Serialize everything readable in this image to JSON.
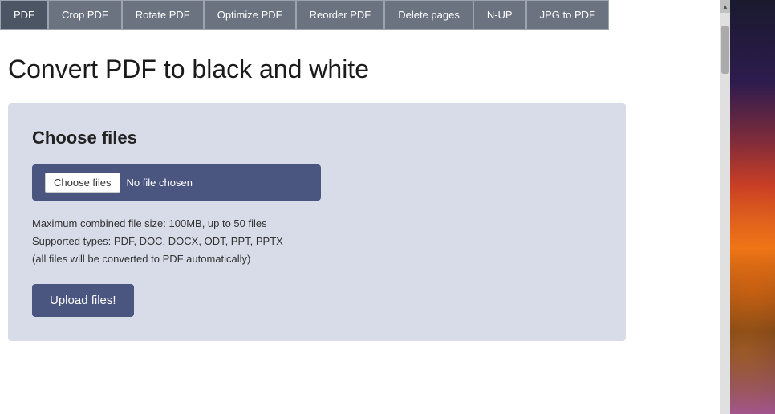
{
  "toolbar": {
    "buttons": [
      {
        "label": "PDF",
        "id": "pdf"
      },
      {
        "label": "Crop PDF",
        "id": "crop-pdf"
      },
      {
        "label": "Rotate PDF",
        "id": "rotate-pdf"
      },
      {
        "label": "Optimize PDF",
        "id": "optimize-pdf"
      },
      {
        "label": "Reorder PDF",
        "id": "reorder-pdf"
      },
      {
        "label": "Delete pages",
        "id": "delete-pages"
      },
      {
        "label": "N-UP",
        "id": "n-up"
      },
      {
        "label": "JPG to PDF",
        "id": "jpg-to-pdf"
      }
    ]
  },
  "page": {
    "title": "Convert PDF to black and white",
    "upload_section": {
      "heading": "Choose files",
      "file_button_label": "Choose files",
      "no_file_text": "No file chosen",
      "info_line1": "Maximum combined file size: 100MB, up to 50 files",
      "info_line2": "Supported types: PDF, DOC, DOCX, ODT, PPT, PPTX",
      "info_line3": "(all files will be converted to PDF automatically)",
      "upload_button_label": "Upload files!"
    }
  }
}
